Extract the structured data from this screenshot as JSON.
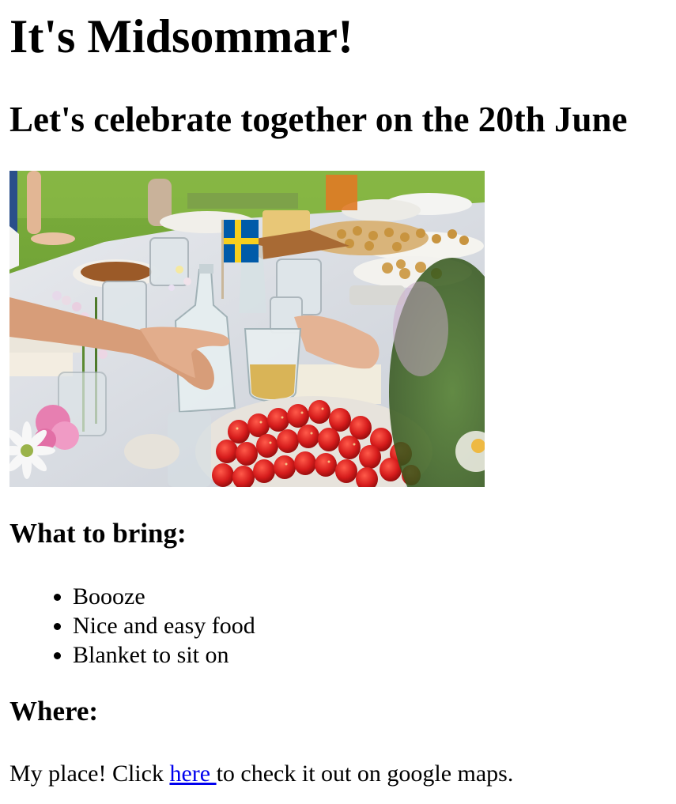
{
  "header": {
    "title": "It's Midsommar!",
    "subtitle": "Let's celebrate together on the 20th June"
  },
  "image": {
    "subject": "midsummer-table-photo",
    "flag_colors": {
      "blue": "#005ba9",
      "yellow": "#f7cf1d"
    }
  },
  "bring": {
    "heading": "What to bring:",
    "items": [
      {
        "label": "Boooze"
      },
      {
        "label": "Nice and easy food"
      },
      {
        "label": "Blanket to sit on"
      }
    ]
  },
  "where": {
    "heading": "Where:",
    "text_before": "My place! Click ",
    "link_label": "here ",
    "text_after": "to check it out on google maps."
  },
  "colors": {
    "link": "#0000ee",
    "text": "#000000",
    "background": "#ffffff"
  }
}
